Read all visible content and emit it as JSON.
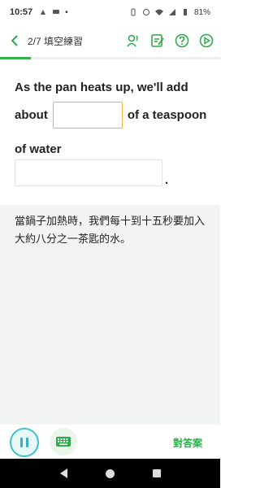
{
  "status_bar": {
    "time": "10:57",
    "battery": "81%"
  },
  "header": {
    "progress_label": "2/7 填空練習",
    "progress_fraction": 0.14
  },
  "question": {
    "line1": "As the pan heats up, we'll add",
    "before_blank1": "about",
    "blank1_value": "",
    "after_blank1": "of a teaspoon",
    "line3": "of water",
    "blank2_value": "",
    "end_punct": "."
  },
  "translation": {
    "text": "當鍋子加熱時，我們每十到十五秒要加入大約八分之一茶匙的水。"
  },
  "controls": {
    "answer_label": "對答案"
  },
  "icons": {
    "back": "chevron-left-icon",
    "person_sound": "person-speak-icon",
    "edit": "edit-note-icon",
    "help": "question-circle-icon",
    "play": "play-circle-icon",
    "pause": "pause-icon",
    "keyboard": "keyboard-icon"
  },
  "colors": {
    "accent_green": "#2eaa4a",
    "blank_highlight": "#f3b03b",
    "pause_teal": "#40c0c9",
    "translation_bg": "#f1f4f3"
  }
}
